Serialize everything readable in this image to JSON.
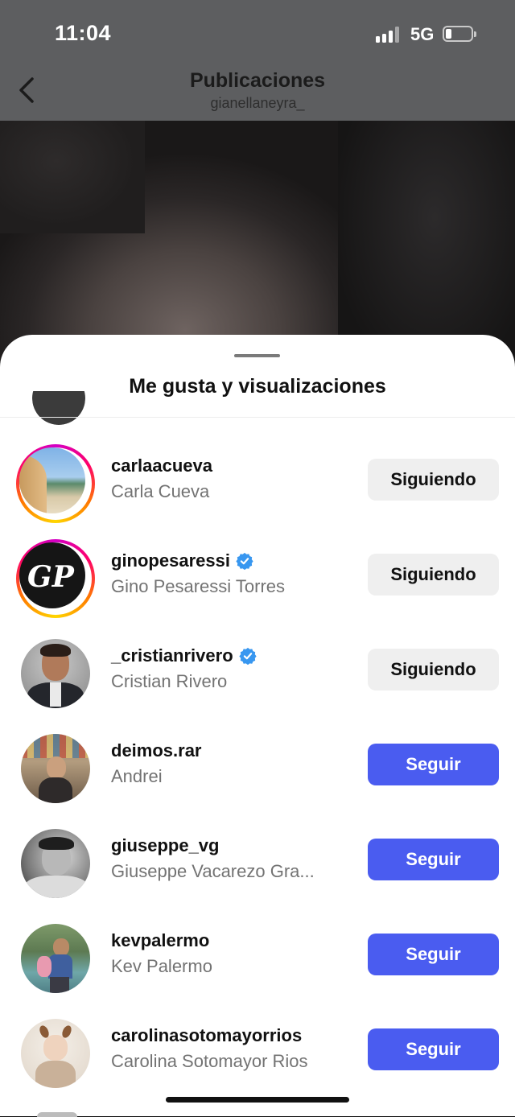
{
  "status_bar": {
    "time": "11:04",
    "network": "5G"
  },
  "nav": {
    "title": "Publicaciones",
    "subtitle": "gianellaneyra_"
  },
  "sheet": {
    "title": "Me gusta y visualizaciones"
  },
  "users": [
    {
      "username": "carlaacueva",
      "full_name": "Carla Cueva",
      "verified": false,
      "story_ring": true,
      "button": "Siguiendo",
      "state": "following"
    },
    {
      "username": "ginopesaressi",
      "full_name": "Gino Pesaressi Torres",
      "verified": true,
      "story_ring": true,
      "button": "Siguiendo",
      "state": "following"
    },
    {
      "username": "_cristianrivero",
      "full_name": "Cristian Rivero",
      "verified": true,
      "story_ring": false,
      "button": "Siguiendo",
      "state": "following"
    },
    {
      "username": "deimos.rar",
      "full_name": "Andrei",
      "verified": false,
      "story_ring": false,
      "button": "Seguir",
      "state": "follow"
    },
    {
      "username": "giuseppe_vg",
      "full_name": "Giuseppe Vacarezo Gra...",
      "verified": false,
      "story_ring": false,
      "button": "Seguir",
      "state": "follow"
    },
    {
      "username": "kevpalermo",
      "full_name": "Kev Palermo",
      "verified": false,
      "story_ring": false,
      "button": "Seguir",
      "state": "follow"
    },
    {
      "username": "carolinasotomayorrios",
      "full_name": "Carolina Sotomayor Rios",
      "verified": false,
      "story_ring": false,
      "button": "Seguir",
      "state": "follow"
    }
  ],
  "colors": {
    "follow_button": "#4a5cf0",
    "following_button": "#efefef",
    "verified_badge": "#3897f0"
  },
  "icons": [
    "back-chevron-icon",
    "signal-icon",
    "battery-icon",
    "verified-badge-icon"
  ]
}
